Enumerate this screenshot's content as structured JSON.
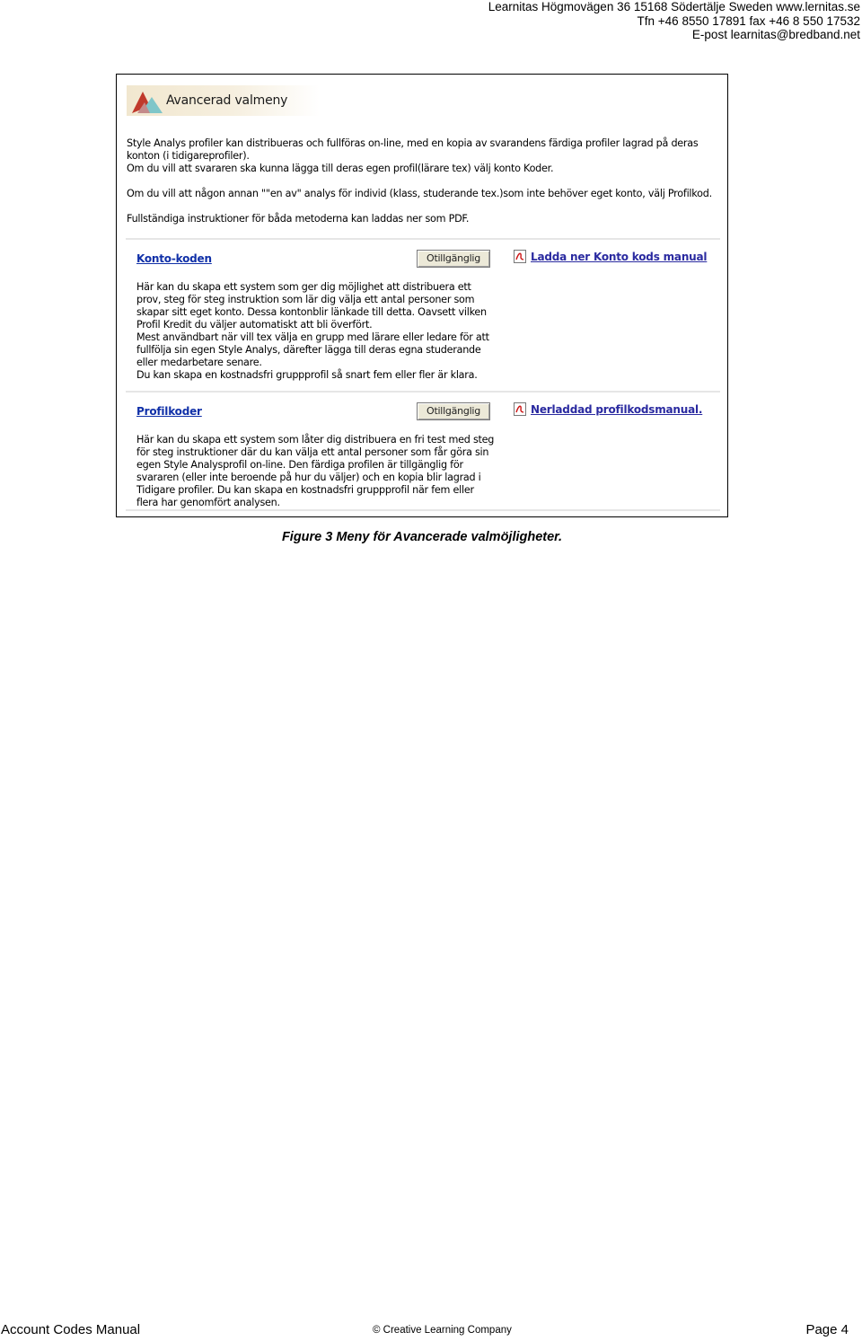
{
  "header": {
    "line1": "Learnitas Högmovägen 36 15168 Södertälje Sweden www.lernitas.se",
    "line2": "Tfn +46 8550 17891 fax +46 8 550 17532",
    "line3": "E-post learnitas@bredband.net"
  },
  "screenshot": {
    "banner_title": "Avancerad valmeny",
    "intro": [
      "Style Analys profiler kan distribueras och fullföras on-line, med en kopia av svarandens färdiga profiler lagrad på deras konton (i tidigareprofiler).",
      "Om du vill att svararen ska kunna lägga till deras egen profil(lärare tex) välj konto Koder.",
      "Om du vill att någon annan \"\"en av\" analys för individ (klass, studerande tex.)som inte behöver eget konto, välj Profilkod.",
      "Fullständiga instruktioner för båda metoderna kan laddas ner som PDF."
    ],
    "sections": [
      {
        "title": "Konto-koden",
        "button": "Otillgänglig",
        "pdf_link": "Ladda ner Konto kods manual",
        "description": [
          "Här kan du skapa ett system som ger dig möjlighet att distribuera ett prov, steg för steg instruktion som lär dig välja ett antal personer som skapar sitt eget konto. Dessa kontonblir länkade till detta. Oavsett vilken Profil Kredit du väljer automatiskt att bli överfört.",
          "Mest användbart när vill tex välja en grupp med lärare eller ledare för att fullfölja sin egen Style Analys, därefter lägga till deras egna studerande eller medarbetare senare.",
          "Du kan skapa en kostnadsfri gruppprofil så snart fem eller fler är klara."
        ]
      },
      {
        "title": "Profilkoder",
        "button": "Otillgänglig",
        "pdf_link": "Nerladdad profilkodsmanual.",
        "description": [
          "Här kan du skapa ett system som låter dig distribuera en fri test med steg för steg instruktioner där du kan välja ett antal personer som får göra sin egen Style Analysprofil on-line. Den färdiga profilen är tillgänglig för svararen (eller inte beroende på hur du väljer) och en kopia blir lagrad i Tidigare profiler. Du kan skapa en kostnadsfri gruppprofil när fem eller flera har genomfört analysen."
        ]
      }
    ]
  },
  "caption": "Figure 3 Meny för Avancerade valmöjligheter.",
  "footer": {
    "left": "Account Codes Manual",
    "center": "© Creative Learning Company",
    "right": "Page 4"
  },
  "icons": [
    "logo-triangles-icon",
    "pdf-icon"
  ]
}
